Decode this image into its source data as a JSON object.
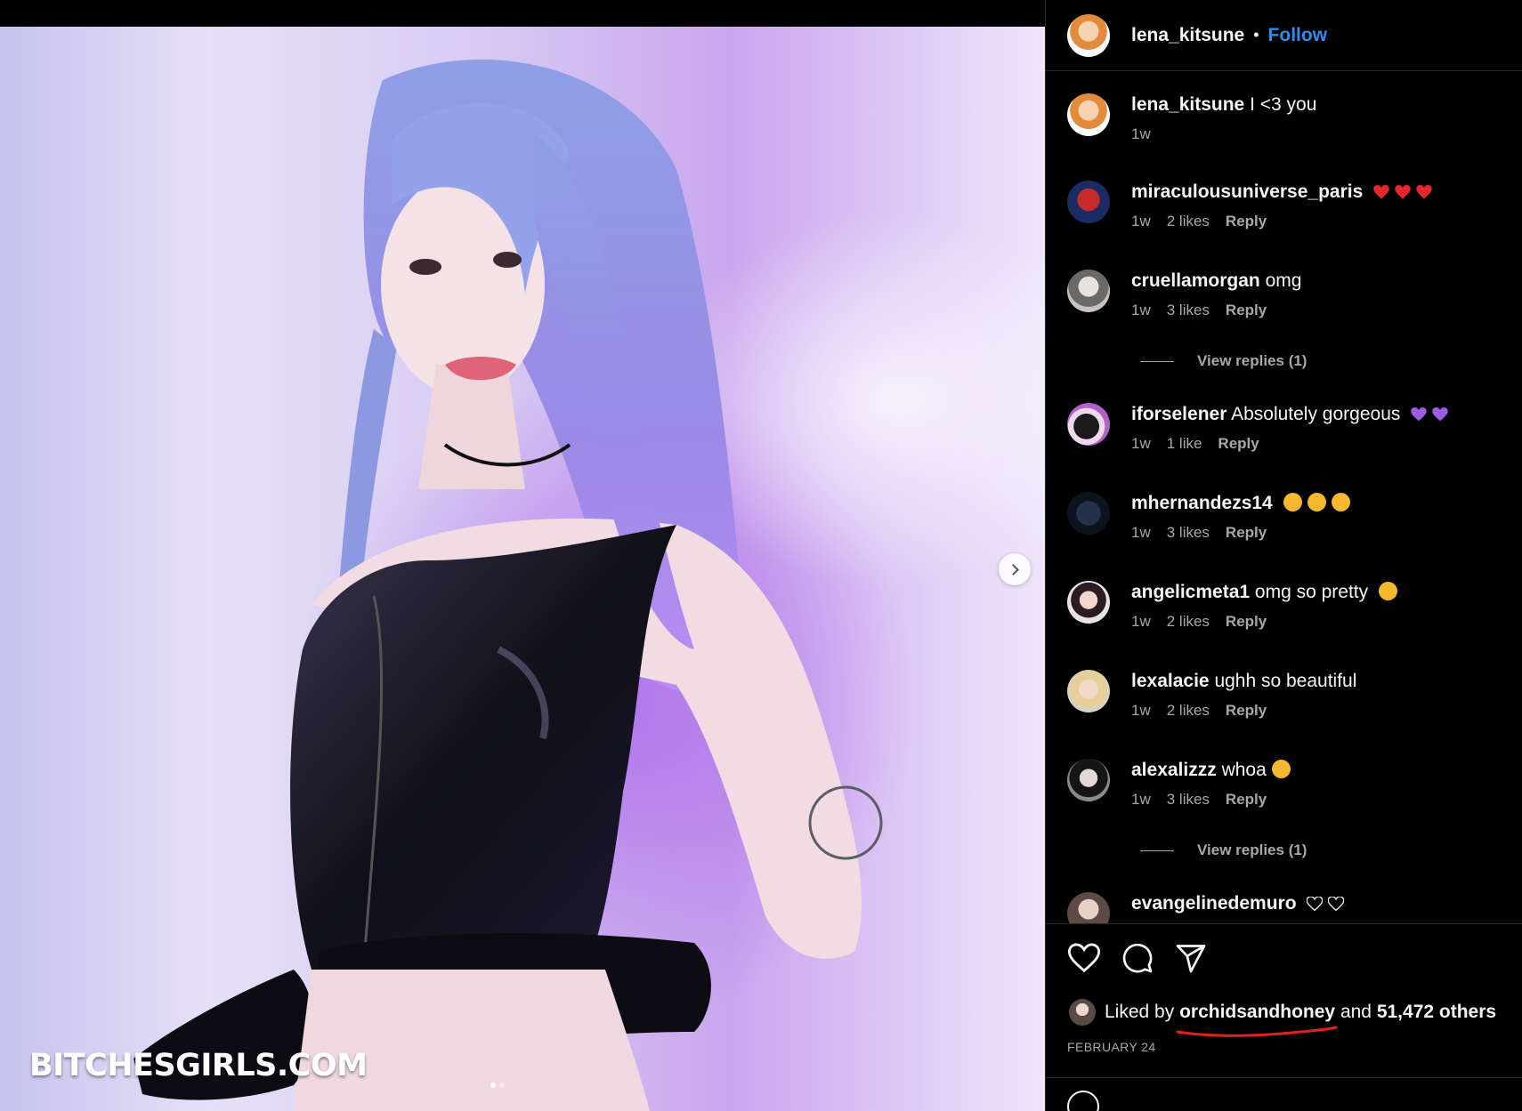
{
  "post": {
    "author": "lena_kitsune",
    "follow_label": "Follow",
    "separator": "•",
    "watermark": "BITCHESGIRLS.COM",
    "slide_count": 2,
    "active_slide": 1
  },
  "caption": {
    "user": "lena_kitsune",
    "text": "I <3 you",
    "time": "1w"
  },
  "comments": [
    {
      "user": "miraculousuniverse_paris",
      "text": "",
      "emoji": [
        "red-heart",
        "red-heart",
        "red-heart"
      ],
      "time": "1w",
      "likes": "2 likes",
      "reply": "Reply"
    },
    {
      "user": "cruellamorgan",
      "text": "omg",
      "time": "1w",
      "likes": "3 likes",
      "reply": "Reply",
      "view_replies": "View replies (1)"
    },
    {
      "user": "iforselener",
      "text": "Absolutely gorgeous",
      "emoji": [
        "purple-heart",
        "purple-heart"
      ],
      "time": "1w",
      "likes": "1 like",
      "reply": "Reply"
    },
    {
      "user": "mhernandezs14",
      "text": "",
      "emoji": [
        "heart-eyes",
        "heart-eyes",
        "heart-eyes"
      ],
      "time": "1w",
      "likes": "3 likes",
      "reply": "Reply"
    },
    {
      "user": "angelicmeta1",
      "text": "omg so pretty",
      "emoji": [
        "pleading-face"
      ],
      "time": "1w",
      "likes": "2 likes",
      "reply": "Reply"
    },
    {
      "user": "lexalacie",
      "text": "ughh so beautiful",
      "time": "1w",
      "likes": "2 likes",
      "reply": "Reply"
    },
    {
      "user": "alexalizzz",
      "text": "whoa",
      "emoji": [
        "heart-eyes"
      ],
      "time": "1w",
      "likes": "3 likes",
      "reply": "Reply",
      "view_replies": "View replies (1)"
    },
    {
      "user": "evangelinedemuro",
      "text": "",
      "emoji": [
        "white-heart",
        "white-heart"
      ]
    }
  ],
  "likes": {
    "prefix": "Liked by",
    "user": "orchidsandhoney",
    "connector": "and",
    "others": "51,472 others"
  },
  "date": "FEBRUARY 24",
  "colors": {
    "link": "#2d8df0",
    "muted": "#a8a8a8",
    "text": "#f5f5f5",
    "annotation": "#e0211c"
  }
}
